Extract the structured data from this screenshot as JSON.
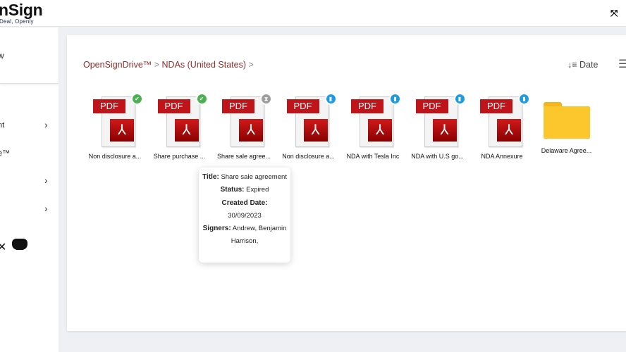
{
  "header": {
    "logo": "nSign",
    "tagline": "Deal, Openly",
    "fullscreen_icon": "expand-icon"
  },
  "sidebar": {
    "top_text": "w",
    "items": [
      {
        "label": "nt",
        "chevron": true
      },
      {
        "label": "e™",
        "chevron": false
      },
      {
        "label": "",
        "chevron": true
      },
      {
        "label": "",
        "chevron": true
      }
    ],
    "social": [
      "x-icon",
      "discord-icon"
    ]
  },
  "main": {
    "breadcrumb": [
      "OpenSignDrive™",
      "NDAs (United States)"
    ],
    "sort_label": "Date",
    "files": [
      {
        "name": "Non disclosure a...",
        "type": "pdf",
        "status": "completed",
        "badge_color": "#4caf50"
      },
      {
        "name": "Share purchase ...",
        "type": "pdf",
        "status": "completed",
        "badge_color": "#4caf50"
      },
      {
        "name": "Share sale agree...",
        "type": "pdf",
        "status": "expired",
        "badge_color": "#9e9e9e"
      },
      {
        "name": "Non disclosure a...",
        "type": "pdf",
        "status": "draft",
        "badge_color": "#1e9be0"
      },
      {
        "name": "NDA with Tesla Inc",
        "type": "pdf",
        "status": "draft",
        "badge_color": "#1e9be0"
      },
      {
        "name": "NDA with U.S go...",
        "type": "pdf",
        "status": "draft",
        "badge_color": "#1e9be0"
      },
      {
        "name": "NDA Annexure",
        "type": "pdf",
        "status": "draft",
        "badge_color": "#1e9be0"
      },
      {
        "name": "Delaware Agree...",
        "type": "folder"
      }
    ]
  },
  "tooltip": {
    "title_label": "Title:",
    "title": "Share sale agreement",
    "status_label": "Status:",
    "status": "Expired",
    "date_label": "Created Date:",
    "date": "30/09/2023",
    "signers_label": "Signers:",
    "signers": "Andrew, Benjamin Harrison,"
  }
}
